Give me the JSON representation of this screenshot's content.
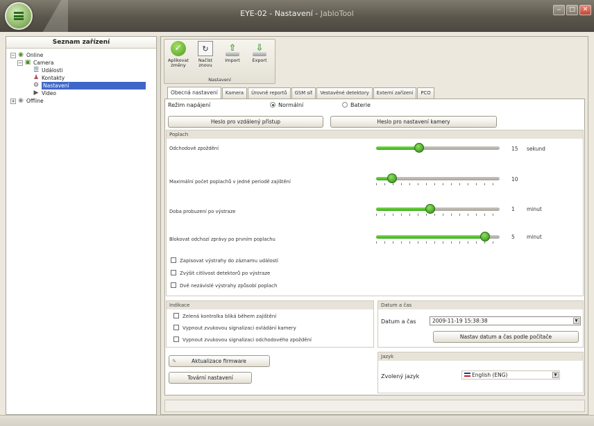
{
  "window": {
    "title_main": "EYE-02 - Nastavení - ",
    "title_app": "JabloTool",
    "buttons": [
      "‒",
      "□",
      "✕"
    ]
  },
  "left_panel": {
    "header": "Seznam zařízení",
    "tree": [
      {
        "label": "Online",
        "expander": "−",
        "icon": "network-icon"
      },
      {
        "label": "Camera",
        "expander": "−",
        "icon": "camera-icon"
      },
      {
        "label": "Události",
        "icon": "events-icon"
      },
      {
        "label": "Kontakty",
        "icon": "contacts-icon"
      },
      {
        "label": "Nastavení",
        "icon": "settings-icon",
        "selected": true
      },
      {
        "label": "Video",
        "icon": "video-icon"
      },
      {
        "label": "Offline",
        "expander": "+",
        "icon": "network-offline-icon"
      }
    ]
  },
  "ribbon": {
    "group_label": "Nastavení",
    "buttons": [
      {
        "label_1": "Aplikovat",
        "label_2": "změny",
        "icon": "apply-check-icon"
      },
      {
        "label_1": "Načíst",
        "label_2": "znovu",
        "icon": "reload-icon"
      },
      {
        "label_1": "Import",
        "label_2": "",
        "icon": "import-icon"
      },
      {
        "label_1": "Export",
        "label_2": "",
        "icon": "export-icon"
      }
    ]
  },
  "tabs": [
    "Obecná nastavení",
    "Kamera",
    "Úrovně reportů",
    "GSM síť",
    "Vestavěné detektory",
    "Externí zařízení",
    "PCO"
  ],
  "general": {
    "power_label": "Režim napájení",
    "power_options": [
      "Normální",
      "Baterie"
    ],
    "power_selected": "Normální",
    "remote_password_button": "Heslo pro vzdálený přístup",
    "camera_password_button": "Heslo pro nastavení kamery"
  },
  "alarm": {
    "header": "Poplach",
    "sliders": [
      {
        "label": "Odchodové zpoždění",
        "value": "15",
        "unit": "sekund",
        "fraction": 0.35
      },
      {
        "label": "Maximální počet poplachů v jedné periodě zajištění",
        "value": "10",
        "unit": "",
        "fraction": 0.13
      },
      {
        "label": "Doba probuzení po výstraze",
        "value": "1",
        "unit": "minut",
        "fraction": 0.44
      },
      {
        "label": "Blokovat odchozí zprávy po prvním poplachu",
        "value": "5",
        "unit": "minut",
        "fraction": 0.88
      }
    ],
    "checkboxes": [
      "Zapisovat výstrahy do záznamu událostí",
      "Zvýšit citlivost detektorů po výstraze",
      "Dvě nezávislé výstrahy způsobí poplach"
    ]
  },
  "indication": {
    "header": "Indikace",
    "checkboxes": [
      "Zelená kontrolka bliká během zajištění",
      "Vypnout zvukovou signalizaci ovládání kamery",
      "Vypnout zvukovou signalizaci odchodového zpoždění"
    ]
  },
  "datetime": {
    "header": "Datum a čas",
    "label": "Datum a čas",
    "value": "2009-11-19 15:38:38",
    "sync_button": "Nastav datum a čas podle počítače"
  },
  "firmware": {
    "update_button": "Aktualizace firmware",
    "factory_button": "Tovární nastavení"
  },
  "language": {
    "header": "Jazyk",
    "label": "Zvolený jazyk",
    "value": "English (ENG)"
  },
  "colors": {
    "accent_green": "#38a81a",
    "selection_blue": "#3f67c8",
    "titlebar": "#5a564c"
  }
}
